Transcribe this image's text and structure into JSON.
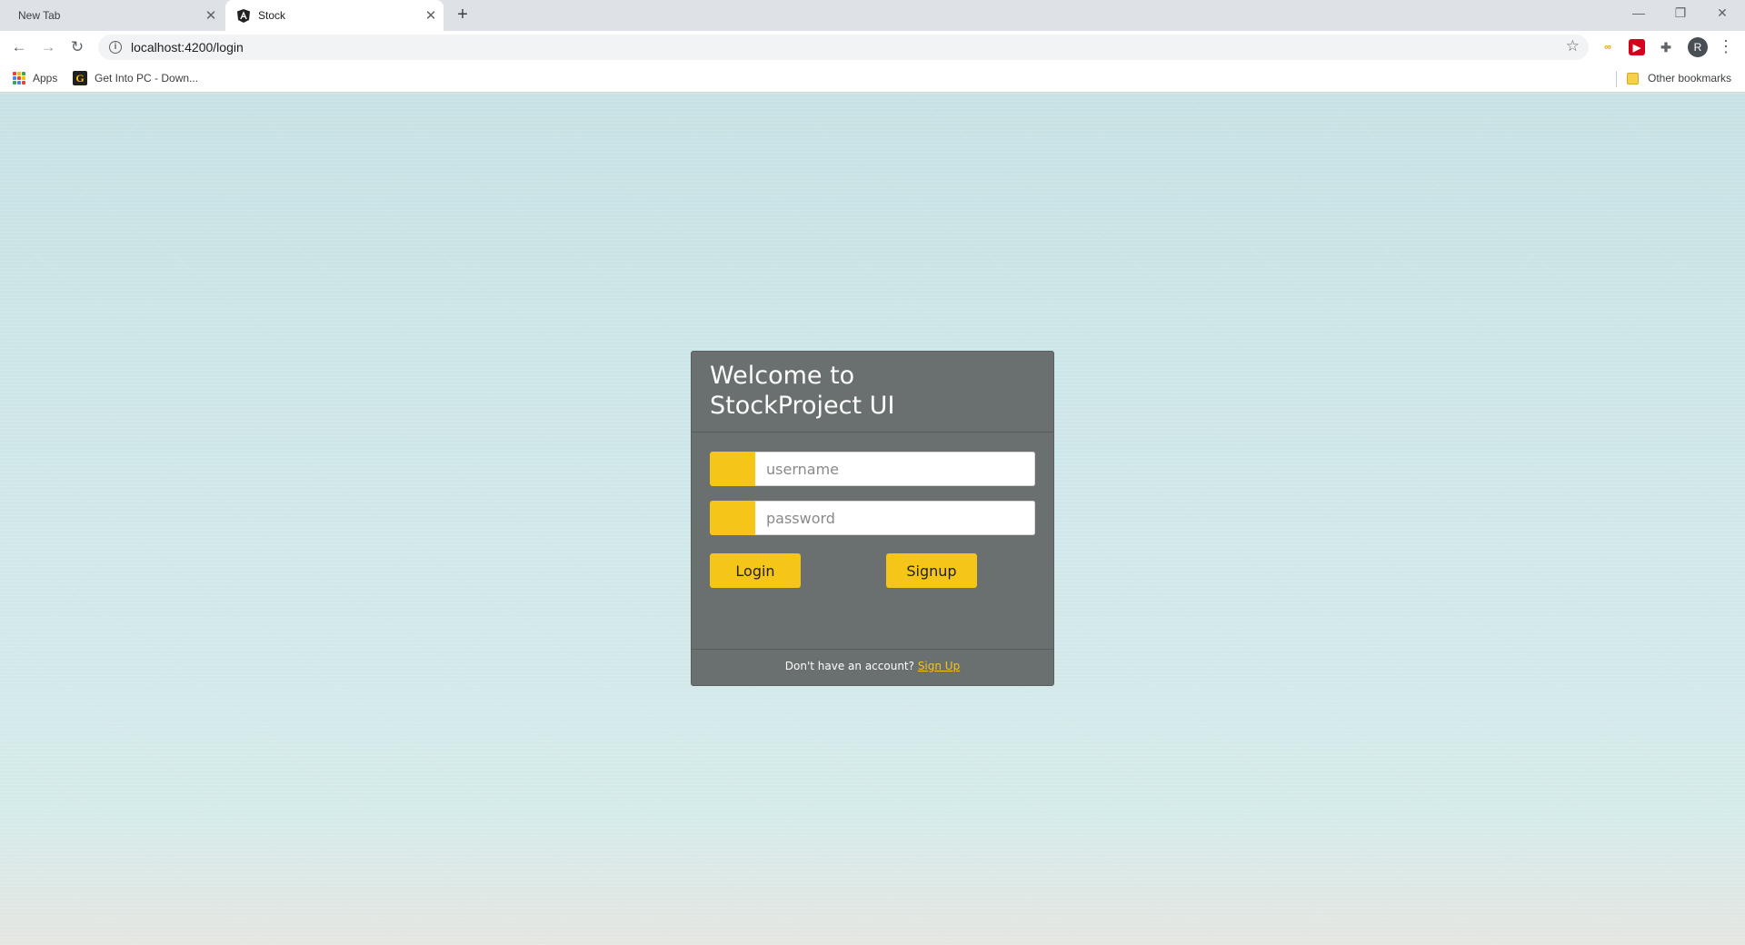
{
  "browser": {
    "tabs": [
      {
        "title": "New Tab",
        "active": false
      },
      {
        "title": "Stock",
        "active": true
      }
    ],
    "address": "localhost:4200/login",
    "bookmarks": [
      {
        "label": "Apps"
      },
      {
        "label": "Get Into PC - Down..."
      }
    ],
    "other_bookmarks": "Other bookmarks",
    "profile_initial": "R"
  },
  "login": {
    "title_line1": "Welcome to",
    "title_line2": "StockProject UI",
    "username_placeholder": "username",
    "password_placeholder": "password",
    "login_label": "Login",
    "signup_label": "Signup",
    "footer_text": "Don't have an account?",
    "footer_link": "Sign Up"
  },
  "colors": {
    "accent": "#f5c518",
    "card_bg": "#6a706f",
    "page_bg": "#cfe7e9"
  }
}
